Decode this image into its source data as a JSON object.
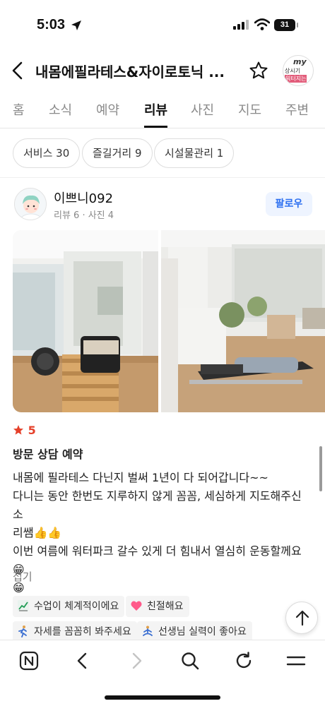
{
  "status_bar": {
    "time": "5:03",
    "battery": "31"
  },
  "header": {
    "title": "내몸에필라테스&자이로토닉 ...",
    "thumb_texts": [
      "my",
      "상시기",
      "워터지는"
    ]
  },
  "tabs": [
    {
      "label": "홈",
      "active": false
    },
    {
      "label": "소식",
      "active": false
    },
    {
      "label": "예약",
      "active": false
    },
    {
      "label": "리뷰",
      "active": true
    },
    {
      "label": "사진",
      "active": false
    },
    {
      "label": "지도",
      "active": false
    },
    {
      "label": "주변",
      "active": false
    }
  ],
  "filter_chips": [
    "서비스 30",
    "즐길거리 9",
    "시설물관리 1"
  ],
  "review": {
    "user_name": "이쁘니092",
    "user_meta": "리뷰 6 · 사진 4",
    "follow_label": "팔로우",
    "rating": "5",
    "visit_info": "방문 상담 예약",
    "body_lines": [
      "내몸에 필라테스 다닌지 벌써 1년이 다 되어갑니다~~",
      "다니는 동안 한번도 지루하지 않게 꼼꼼, 세심하게 지도해주신 소",
      "리쌤👍👍",
      "이번 여름에 워터파크 갈수 있게 더 힘내서 열심히 운동할께요😁",
      "😁"
    ],
    "fold_label": "접기",
    "keywords": [
      {
        "icon": "chart-up-icon",
        "label": "수업이 체계적이에요"
      },
      {
        "icon": "heart-icon",
        "label": "친절해요"
      },
      {
        "icon": "running-person-icon",
        "label": "자세를 꼼꼼히 봐주세요"
      },
      {
        "icon": "meditating-person-icon",
        "label": "선생님 실력이 좋아요"
      }
    ]
  },
  "colors": {
    "accent_blue": "#2c6ff0",
    "star_red": "#e5402a"
  }
}
